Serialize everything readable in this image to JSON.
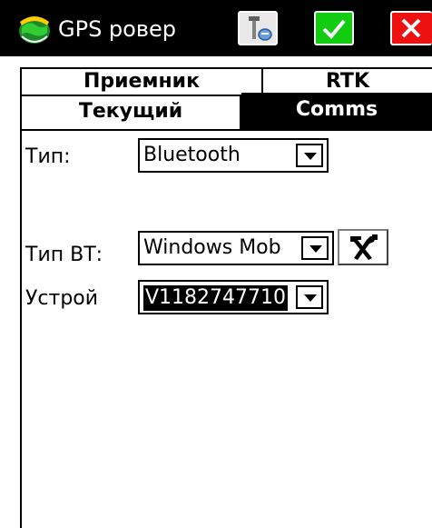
{
  "window": {
    "title": "GPS ровер",
    "app_icon": "gps-globe-icon",
    "buttons": [
      {
        "name": "settings-tool-button",
        "icon": "pole-settings-icon"
      },
      {
        "name": "ok-button",
        "icon": "checkmark-icon"
      },
      {
        "name": "close-button",
        "icon": "close-x-icon"
      }
    ],
    "colors": {
      "titlebar": "#000000",
      "ok": "#11cc11",
      "close": "#ee1111"
    }
  },
  "tabs": {
    "row1": [
      "Приемник",
      "RTK"
    ],
    "row2": [
      "Текущий",
      "Comms"
    ],
    "active": "Comms"
  },
  "form": {
    "type_label": "Тип:",
    "type_value": "Bluetooth",
    "bt_type_label": "Тип ВТ:",
    "bt_type_value": "Windows Mob",
    "bt_settings_icon": "hammer-wrench-icon",
    "device_label": "Устрой",
    "device_value": "V1182747710"
  }
}
